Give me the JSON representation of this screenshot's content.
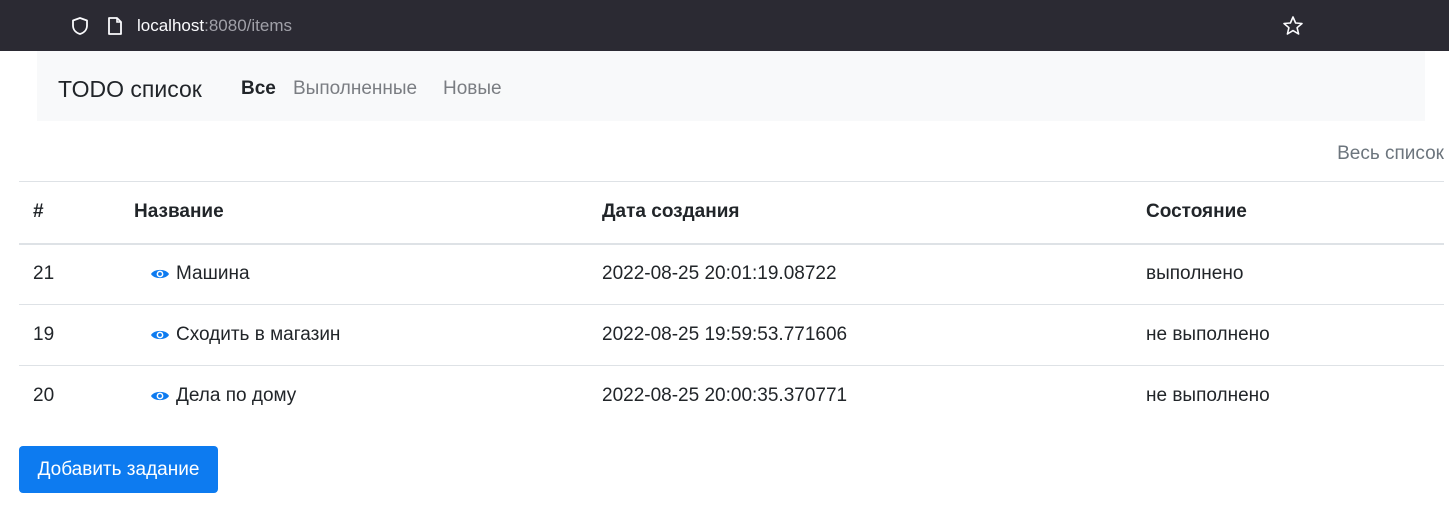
{
  "browser": {
    "url_host": "localhost",
    "url_rest": ":8080/items",
    "icons": [
      "shield-icon",
      "page-icon",
      "star-icon"
    ]
  },
  "navbar": {
    "brand": "TODO список",
    "links": [
      {
        "label": "Все",
        "active": true
      },
      {
        "label": "Выполненные",
        "active": false
      },
      {
        "label": "Новые",
        "active": false
      }
    ]
  },
  "full_list_link": "Весь список",
  "table": {
    "headers": [
      "#",
      "Название",
      "Дата создания",
      "Состояние"
    ],
    "rows": [
      {
        "id": "21",
        "name": "Машина",
        "created": "2022-08-25 20:01:19.08722",
        "status": "выполнено"
      },
      {
        "id": "19",
        "name": "Сходить в магазин",
        "created": "2022-08-25 19:59:53.771606",
        "status": "не выполнено"
      },
      {
        "id": "20",
        "name": "Дела по дому",
        "created": "2022-08-25 20:00:35.370771",
        "status": "не выполнено"
      }
    ]
  },
  "add_button": "Добавить задание",
  "colors": {
    "browser_bar": "#2b2a33",
    "navbar_bg": "#f8f9fa",
    "primary": "#0d7bf0",
    "eye_icon": "#0d7bf0"
  }
}
